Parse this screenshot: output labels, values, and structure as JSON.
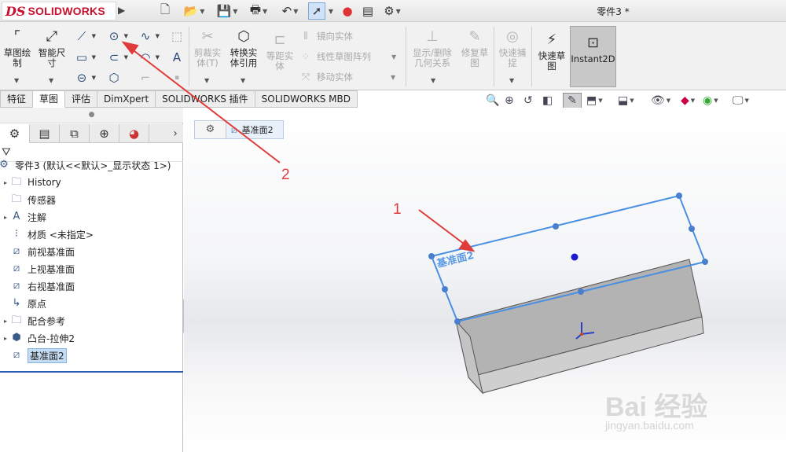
{
  "app": {
    "logo_mark": "DS",
    "brand": "SOLIDWORKS",
    "document_title": "零件3 *"
  },
  "quick_access": [
    "new-file-icon",
    "open-file-icon",
    "save-icon",
    "print-icon",
    "undo-icon",
    "select-pointer-icon",
    "traffic-light-icon",
    "file-properties-icon",
    "options-gear-icon"
  ],
  "ribbon": {
    "sketch_label": "草图绘\n制",
    "smart_dim_label": "智能尺\n寸",
    "trim_label": "剪裁实\n体(T)",
    "convert_label": "转换实\n体引用",
    "offset_label": "等距实\n体",
    "mirror_label": "镜向实体",
    "linear_pattern_label": "线性草图阵列",
    "move_label": "移动实体",
    "relations_label": "显示/删除\n几何关系",
    "repair_label": "修复草\n图",
    "quick_snap_label": "快速捕\n捉",
    "rapid_sketch_label": "快速草\n图",
    "instant2d_label": "Instant2D"
  },
  "tabs": [
    {
      "label": "特征",
      "active": false
    },
    {
      "label": "草图",
      "active": true
    },
    {
      "label": "评估",
      "active": false
    },
    {
      "label": "DimXpert",
      "active": false
    },
    {
      "label": "SOLIDWORKS 插件",
      "active": false
    },
    {
      "label": "SOLIDWORKS MBD",
      "active": false
    }
  ],
  "feature_tree": {
    "root": "零件3 (默认<<默认>_显示状态 1>)",
    "items": [
      {
        "label": "History",
        "icon": "history-folder-icon",
        "expandable": true
      },
      {
        "label": "传感器",
        "icon": "sensor-folder-icon",
        "expandable": false
      },
      {
        "label": "注解",
        "icon": "annotations-icon",
        "expandable": true
      },
      {
        "label": "材质 <未指定>",
        "icon": "material-icon",
        "expandable": false
      },
      {
        "label": "前视基准面",
        "icon": "plane-icon",
        "expandable": false
      },
      {
        "label": "上视基准面",
        "icon": "plane-icon",
        "expandable": false
      },
      {
        "label": "右视基准面",
        "icon": "plane-icon",
        "expandable": false
      },
      {
        "label": "原点",
        "icon": "origin-icon",
        "expandable": false
      },
      {
        "label": "配合参考",
        "icon": "mate-reference-icon",
        "expandable": true
      },
      {
        "label": "凸台-拉伸2",
        "icon": "extrude-boss-icon",
        "expandable": true
      },
      {
        "label": "基准面2",
        "icon": "plane-icon",
        "expandable": false,
        "selected": true
      }
    ]
  },
  "graphics": {
    "breadcrumb_label": "基准面2",
    "plane_label": "基准面2",
    "annotation_1": "1",
    "annotation_2": "2",
    "watermark": "Bai 经验",
    "watermark_url": "jingyan.baidu.com"
  },
  "colors": {
    "brand_red": "#c8102e",
    "plane_blue": "#4a90e2",
    "arrow_red": "#e03a3a",
    "box_gray": "#b3b3b3"
  }
}
